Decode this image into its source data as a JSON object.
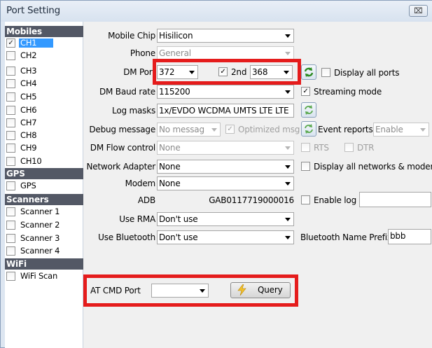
{
  "window": {
    "title": "Port Setting",
    "close_label": "⌧"
  },
  "sidebar": {
    "sections": [
      {
        "title": "Mobiles",
        "items": [
          {
            "label": "CH1",
            "checked": true,
            "selected": true
          },
          {
            "label": "CH2",
            "checked": false
          },
          {
            "label": "CH3",
            "checked": false
          },
          {
            "label": "CH4",
            "checked": false
          },
          {
            "label": "CH5",
            "checked": false
          },
          {
            "label": "CH6",
            "checked": false
          },
          {
            "label": "CH7",
            "checked": false
          },
          {
            "label": "CH8",
            "checked": false
          },
          {
            "label": "CH9",
            "checked": false
          },
          {
            "label": "CH10",
            "checked": false
          }
        ]
      },
      {
        "title": "GPS",
        "items": [
          {
            "label": "GPS",
            "checked": false
          }
        ]
      },
      {
        "title": "Scanners",
        "items": [
          {
            "label": "Scanner 1",
            "checked": false
          },
          {
            "label": "Scanner 2",
            "checked": false
          },
          {
            "label": "Scanner 3",
            "checked": false
          },
          {
            "label": "Scanner 4",
            "checked": false
          }
        ]
      },
      {
        "title": "WiFi",
        "items": [
          {
            "label": "WiFi Scan",
            "checked": false
          }
        ]
      }
    ]
  },
  "form": {
    "mobile_chip": {
      "label": "Mobile Chip",
      "value": "Hisilicon"
    },
    "phone": {
      "label": "Phone",
      "value": "General"
    },
    "dm_port": {
      "label": "DM Port",
      "value": "372",
      "second_label": "2nd",
      "second_checked": true,
      "second_value": "368",
      "display_all_label": "Display all ports"
    },
    "dm_baud": {
      "label": "DM Baud rate",
      "value": "115200",
      "streaming_label": "Streaming mode",
      "streaming_checked": true
    },
    "log_masks": {
      "label": "Log masks",
      "value": "1x/EVDO WCDMA UMTS LTE LTE"
    },
    "debug": {
      "label": "Debug message",
      "value": "No messag",
      "optimized_label": "Optimized msg",
      "event_label": "Event reports",
      "event_value": "Enable"
    },
    "dm_flow": {
      "label": "DM Flow control",
      "value": "None",
      "rts_label": "RTS",
      "dtr_label": "DTR"
    },
    "network_adapter": {
      "label": "Network Adapter",
      "value": "None",
      "display_all_label": "Display all networks & modems"
    },
    "modem": {
      "label": "Modem",
      "value": "None"
    },
    "adb": {
      "label": "ADB",
      "value": "GAB0117719000016",
      "enable_log_label": "Enable log",
      "enable_log_value": ""
    },
    "use_rma": {
      "label": "Use RMA",
      "value": "Don't use"
    },
    "use_bluetooth": {
      "label": "Use Bluetooth",
      "value": "Don't use",
      "prefix_label": "Bluetooth Name Prefix",
      "prefix_value": "bbb"
    },
    "at_cmd": {
      "label": "AT CMD Port",
      "value": "",
      "query_label": "Query"
    }
  },
  "colors": {
    "highlight": "#e51c1c",
    "selection": "#3399ff",
    "section_header": "#535865"
  }
}
